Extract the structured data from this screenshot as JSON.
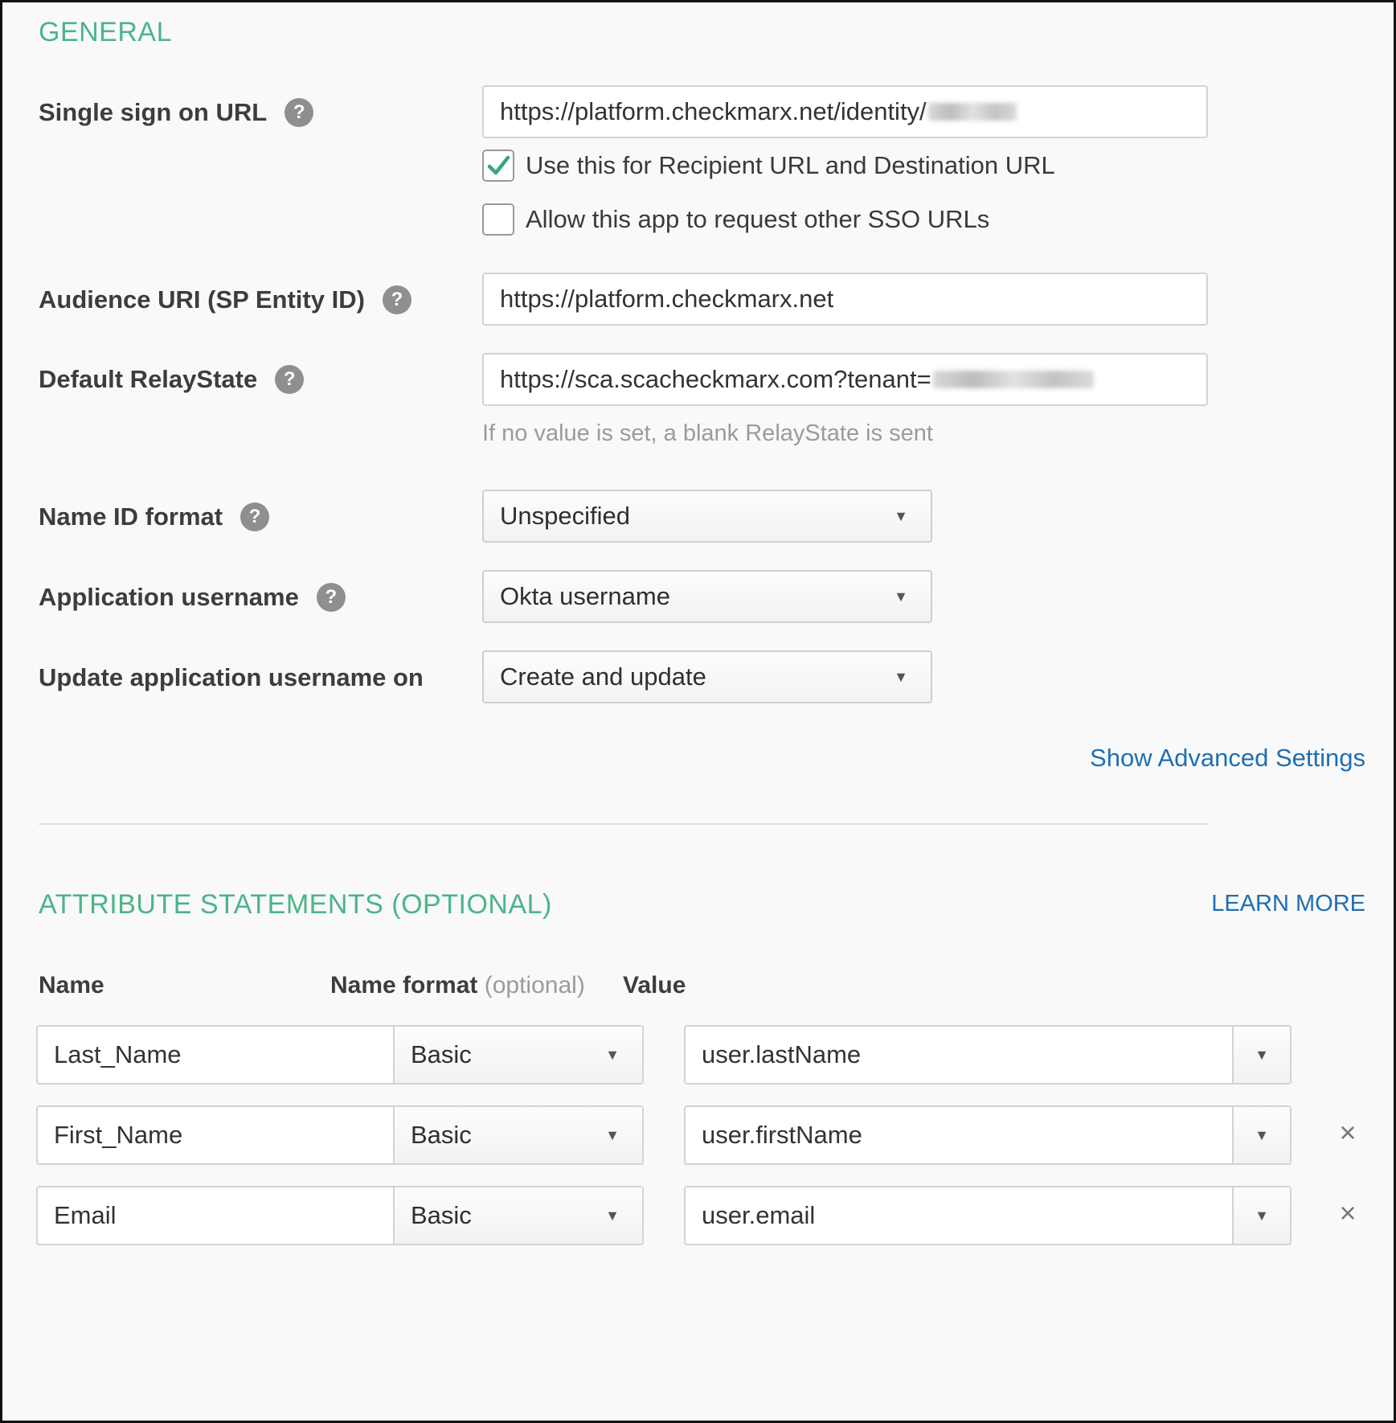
{
  "general": {
    "title": "GENERAL",
    "sso_url": {
      "label": "Single sign on URL",
      "value": "https://platform.checkmarx.net/identity/",
      "use_for_recipient": {
        "label": "Use this for Recipient URL and Destination URL",
        "checked": true
      },
      "allow_other_sso": {
        "label": "Allow this app to request other SSO URLs",
        "checked": false
      }
    },
    "audience_uri": {
      "label": "Audience URI (SP Entity ID)",
      "value": "https://platform.checkmarx.net"
    },
    "relay_state": {
      "label": "Default RelayState",
      "value": "https://sca.scacheckmarx.com?tenant=",
      "hint": "If no value is set, a blank RelayState is sent"
    },
    "name_id_format": {
      "label": "Name ID format",
      "value": "Unspecified"
    },
    "app_username": {
      "label": "Application username",
      "value": "Okta username"
    },
    "update_username": {
      "label": "Update application username on",
      "value": "Create and update"
    },
    "advanced_link": "Show Advanced Settings"
  },
  "attributes": {
    "title": "ATTRIBUTE STATEMENTS (OPTIONAL)",
    "learn_more": "LEARN MORE",
    "columns": {
      "name": "Name",
      "format": "Name format",
      "format_optional": "(optional)",
      "value": "Value"
    },
    "rows": [
      {
        "name": "Last_Name",
        "format": "Basic",
        "value": "user.lastName",
        "removable": false
      },
      {
        "name": "First_Name",
        "format": "Basic",
        "value": "user.firstName",
        "removable": true
      },
      {
        "name": "Email",
        "format": "Basic",
        "value": "user.email",
        "removable": true
      }
    ]
  },
  "icons": {
    "help": "?",
    "caret": "▼",
    "remove": "×"
  },
  "colors": {
    "section_title": "#4cb48a",
    "link": "#1f6fb2",
    "checkmark": "#3aa67c",
    "help_bg": "#8f8f8f"
  }
}
